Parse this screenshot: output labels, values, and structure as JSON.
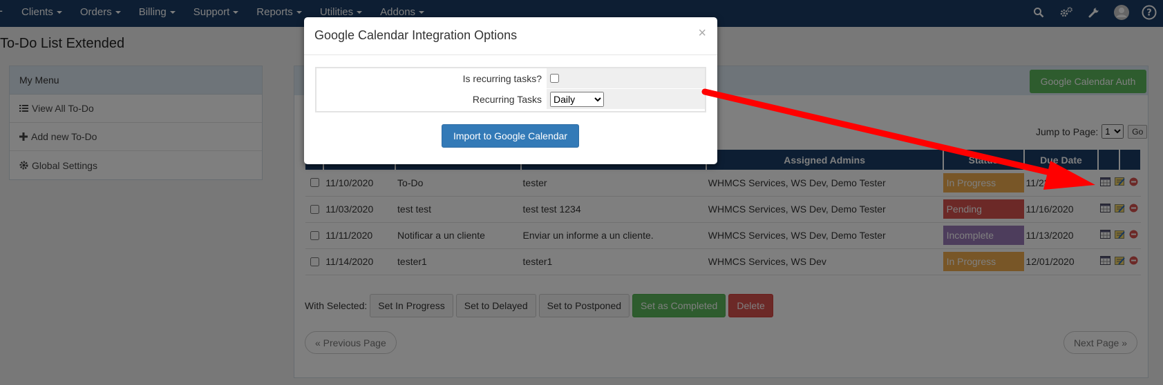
{
  "nav": {
    "items": [
      "Clients",
      "Orders",
      "Billing",
      "Support",
      "Reports",
      "Utilities",
      "Addons"
    ],
    "icons": [
      "search-icon",
      "cogs-icon",
      "wrench-icon",
      "user-avatar-icon",
      "help-icon"
    ]
  },
  "page": {
    "title": "To-Do List Extended"
  },
  "sidebar": {
    "header": "My Menu",
    "items": [
      {
        "label": "View All To-Do",
        "icon": "list-icon"
      },
      {
        "label": "Add new To-Do",
        "icon": "plus-icon"
      },
      {
        "label": "Global Settings",
        "icon": "gear-icon"
      }
    ]
  },
  "panel": {
    "auth_button": "Google Calendar Auth",
    "jump_label": "Jump to Page:",
    "jump_value": "1",
    "go_label": "Go"
  },
  "table": {
    "headers": [
      "Assigned Admins",
      "Status",
      "Due Date"
    ],
    "rows": [
      {
        "date": "11/10/2020",
        "title": "To-Do",
        "description": "tester",
        "admins": "WHMCS Services, WS Dev, Demo Tester",
        "status": "In Progress",
        "status_color": "#f0ad4e",
        "due": "11/23/2020"
      },
      {
        "date": "11/03/2020",
        "title": "test test",
        "description": "test test 1234",
        "admins": "WHMCS Services, WS Dev, Demo Tester",
        "status": "Pending",
        "status_color": "#d9534f",
        "due": "11/16/2020"
      },
      {
        "date": "11/11/2020",
        "title": "Notificar a un cliente",
        "description": "Enviar un informe a un cliente.",
        "admins": "WHMCS Services, WS Dev, Demo Tester",
        "status": "Incomplete",
        "status_color": "#9b7bb8",
        "due": "11/13/2020"
      },
      {
        "date": "11/14/2020",
        "title": "tester1",
        "description": "tester1",
        "admins": "WHMCS Services, WS Dev",
        "status": "In Progress",
        "status_color": "#f0ad4e",
        "due": "12/01/2020"
      }
    ]
  },
  "actions": {
    "label": "With Selected:",
    "buttons": [
      "Set In Progress",
      "Set to Delayed",
      "Set to Postponed",
      "Set as Completed",
      "Delete"
    ]
  },
  "pagination": {
    "prev": "« Previous Page",
    "next": "Next Page »"
  },
  "modal": {
    "title": "Google Calendar Integration Options",
    "close": "×",
    "recurring_label": "Is recurring tasks?",
    "recurring_checked": false,
    "tasks_label": "Recurring Tasks",
    "tasks_value": "Daily",
    "import_button": "Import to Google Calendar"
  },
  "colors": {
    "nav": "#1a3d66",
    "arrow": "#ff0000",
    "green": "#5cb85c",
    "red": "#d9534f",
    "primary": "#337ab7"
  }
}
